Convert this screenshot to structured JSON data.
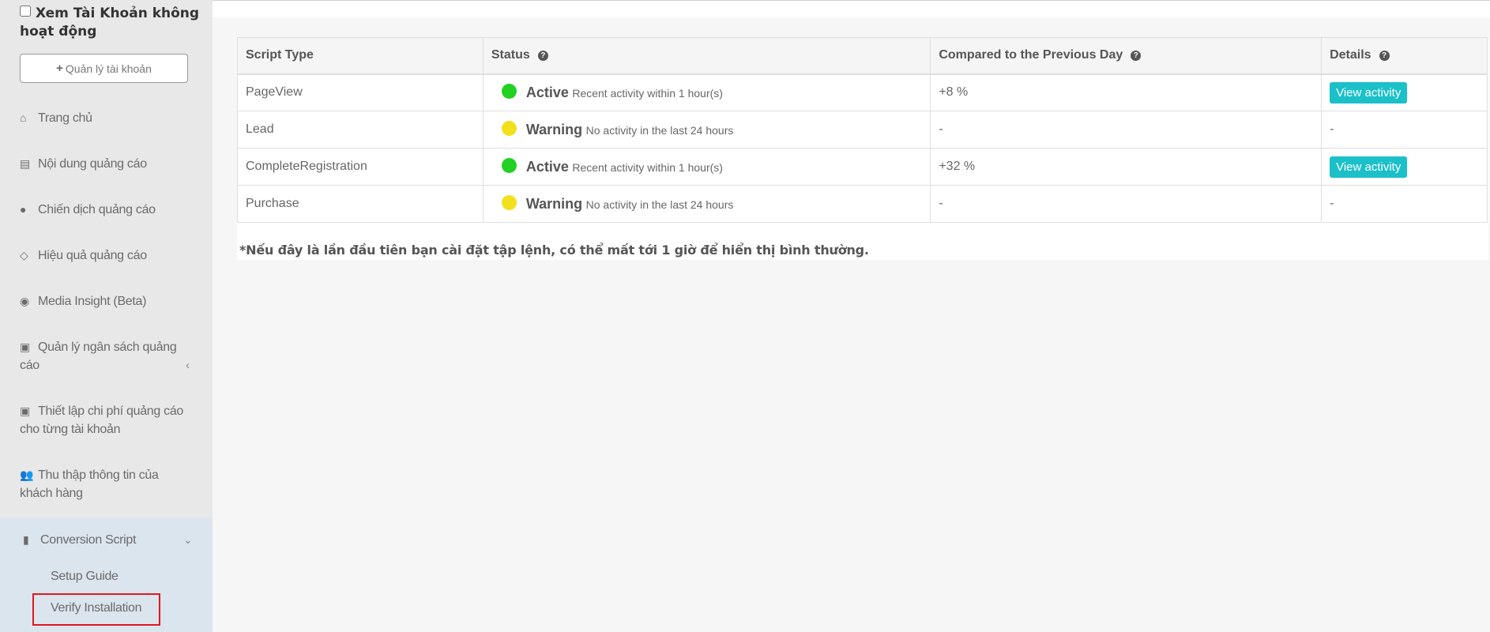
{
  "sidebar": {
    "inactive_label": "Xem Tài Khoản không hoạt động",
    "manage_button": "Quản lý tài khoản",
    "items": [
      {
        "label": "Trang chủ",
        "icon": "home-icon"
      },
      {
        "label": "Nội dung quảng cáo",
        "icon": "list-alt-icon"
      },
      {
        "label": "Chiến dịch quảng cáo",
        "icon": "globe-icon"
      },
      {
        "label": "Hiệu quả quảng cáo",
        "icon": "diamond-icon"
      },
      {
        "label": "Media Insight (Beta)",
        "icon": "eye-icon"
      },
      {
        "label": "Quản lý ngân sách quảng cáo",
        "icon": "money-icon"
      },
      {
        "label": "Thiết lập chi phí quảng cáo cho từng tài khoản",
        "icon": "money-icon"
      },
      {
        "label": "Thu thập thông tin của khách hàng",
        "icon": "users-icon"
      }
    ],
    "conversion": {
      "label": "Conversion Script",
      "icon": "book-icon",
      "sub_items": [
        "Setup Guide",
        "Verify Installation"
      ]
    }
  },
  "table": {
    "headers": {
      "script_type": "Script Type",
      "status": "Status",
      "compared": "Compared to the Previous Day",
      "details": "Details"
    },
    "rows": [
      {
        "script": "PageView",
        "status": "Active",
        "status_note": "Recent activity within 1 hour(s)",
        "dot_color": "#22d122",
        "delta": "+8 %",
        "details": "View activity"
      },
      {
        "script": "Lead",
        "status": "Warning",
        "status_note": "No activity in the last 24 hours",
        "dot_color": "#f2e01c",
        "delta": "-",
        "details": "-"
      },
      {
        "script": "CompleteRegistration",
        "status": "Active",
        "status_note": "Recent activity within 1 hour(s)",
        "dot_color": "#22d122",
        "delta": "+32 %",
        "details": "View activity"
      },
      {
        "script": "Purchase",
        "status": "Warning",
        "status_note": "No activity in the last 24 hours",
        "dot_color": "#f2e01c",
        "delta": "-",
        "details": "-"
      }
    ]
  },
  "note": "*Nếu đây là lần đầu tiên bạn cài đặt tập lệnh, có thể mất tới 1 giờ để hiển thị bình thường.",
  "colors": {
    "accent": "#1bc0c8",
    "positive": "#5cc55c",
    "active_dot": "#22d122",
    "warning_dot": "#f2e01c",
    "highlight_border": "#e0171f"
  }
}
